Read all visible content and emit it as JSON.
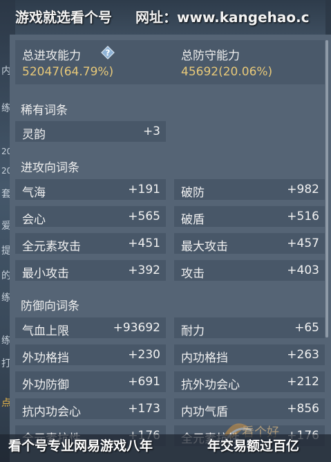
{
  "watermark": {
    "top_left": "易游戏就选看个号",
    "top_right": "网址：www.kangehao.c",
    "bottom_left": "看个号专业网易游戏八年",
    "bottom_right": "年交易额过百亿",
    "logo_text": "看个好"
  },
  "summary": {
    "attack_label": "总进攻能力",
    "attack_value": "52047(64.79%)",
    "defense_label": "总防守能力",
    "defense_value": "45692(20.06%)"
  },
  "sections": {
    "rare": {
      "title": "稀有词条",
      "items": [
        {
          "name": "灵韵",
          "value": "+3"
        }
      ]
    },
    "attack": {
      "title": "进攻向词条",
      "items": [
        {
          "name": "气海",
          "value": "+191"
        },
        {
          "name": "破防",
          "value": "+982"
        },
        {
          "name": "会心",
          "value": "+565"
        },
        {
          "name": "破盾",
          "value": "+516"
        },
        {
          "name": "全元素攻击",
          "value": "+451"
        },
        {
          "name": "最大攻击",
          "value": "+457"
        },
        {
          "name": "最小攻击",
          "value": "+392"
        },
        {
          "name": "攻击",
          "value": "+403"
        }
      ]
    },
    "defense": {
      "title": "防御向词条",
      "items": [
        {
          "name": "气血上限",
          "value": "+93692"
        },
        {
          "name": "耐力",
          "value": "+65"
        },
        {
          "name": "外功格挡",
          "value": "+230"
        },
        {
          "name": "内功格挡",
          "value": "+263"
        },
        {
          "name": "外功防御",
          "value": "+691"
        },
        {
          "name": "抗外功会心",
          "value": "+212"
        },
        {
          "name": "抗内功会心",
          "value": "+173"
        },
        {
          "name": "内功气盾",
          "value": "+856"
        },
        {
          "name": "全元素抗性",
          "value": "+176"
        },
        {
          "name": "全元素抗性",
          "value": "+176"
        }
      ]
    }
  },
  "background_glyphs": [
    "内",
    "练",
    "20",
    "20",
    "套",
    "爱",
    "提",
    "的",
    "练",
    "练",
    "打",
    "点"
  ],
  "colors": {
    "panel": "#556475",
    "row": "#485768",
    "value_gold": "#e8c979",
    "text": "#f2f2f2"
  }
}
